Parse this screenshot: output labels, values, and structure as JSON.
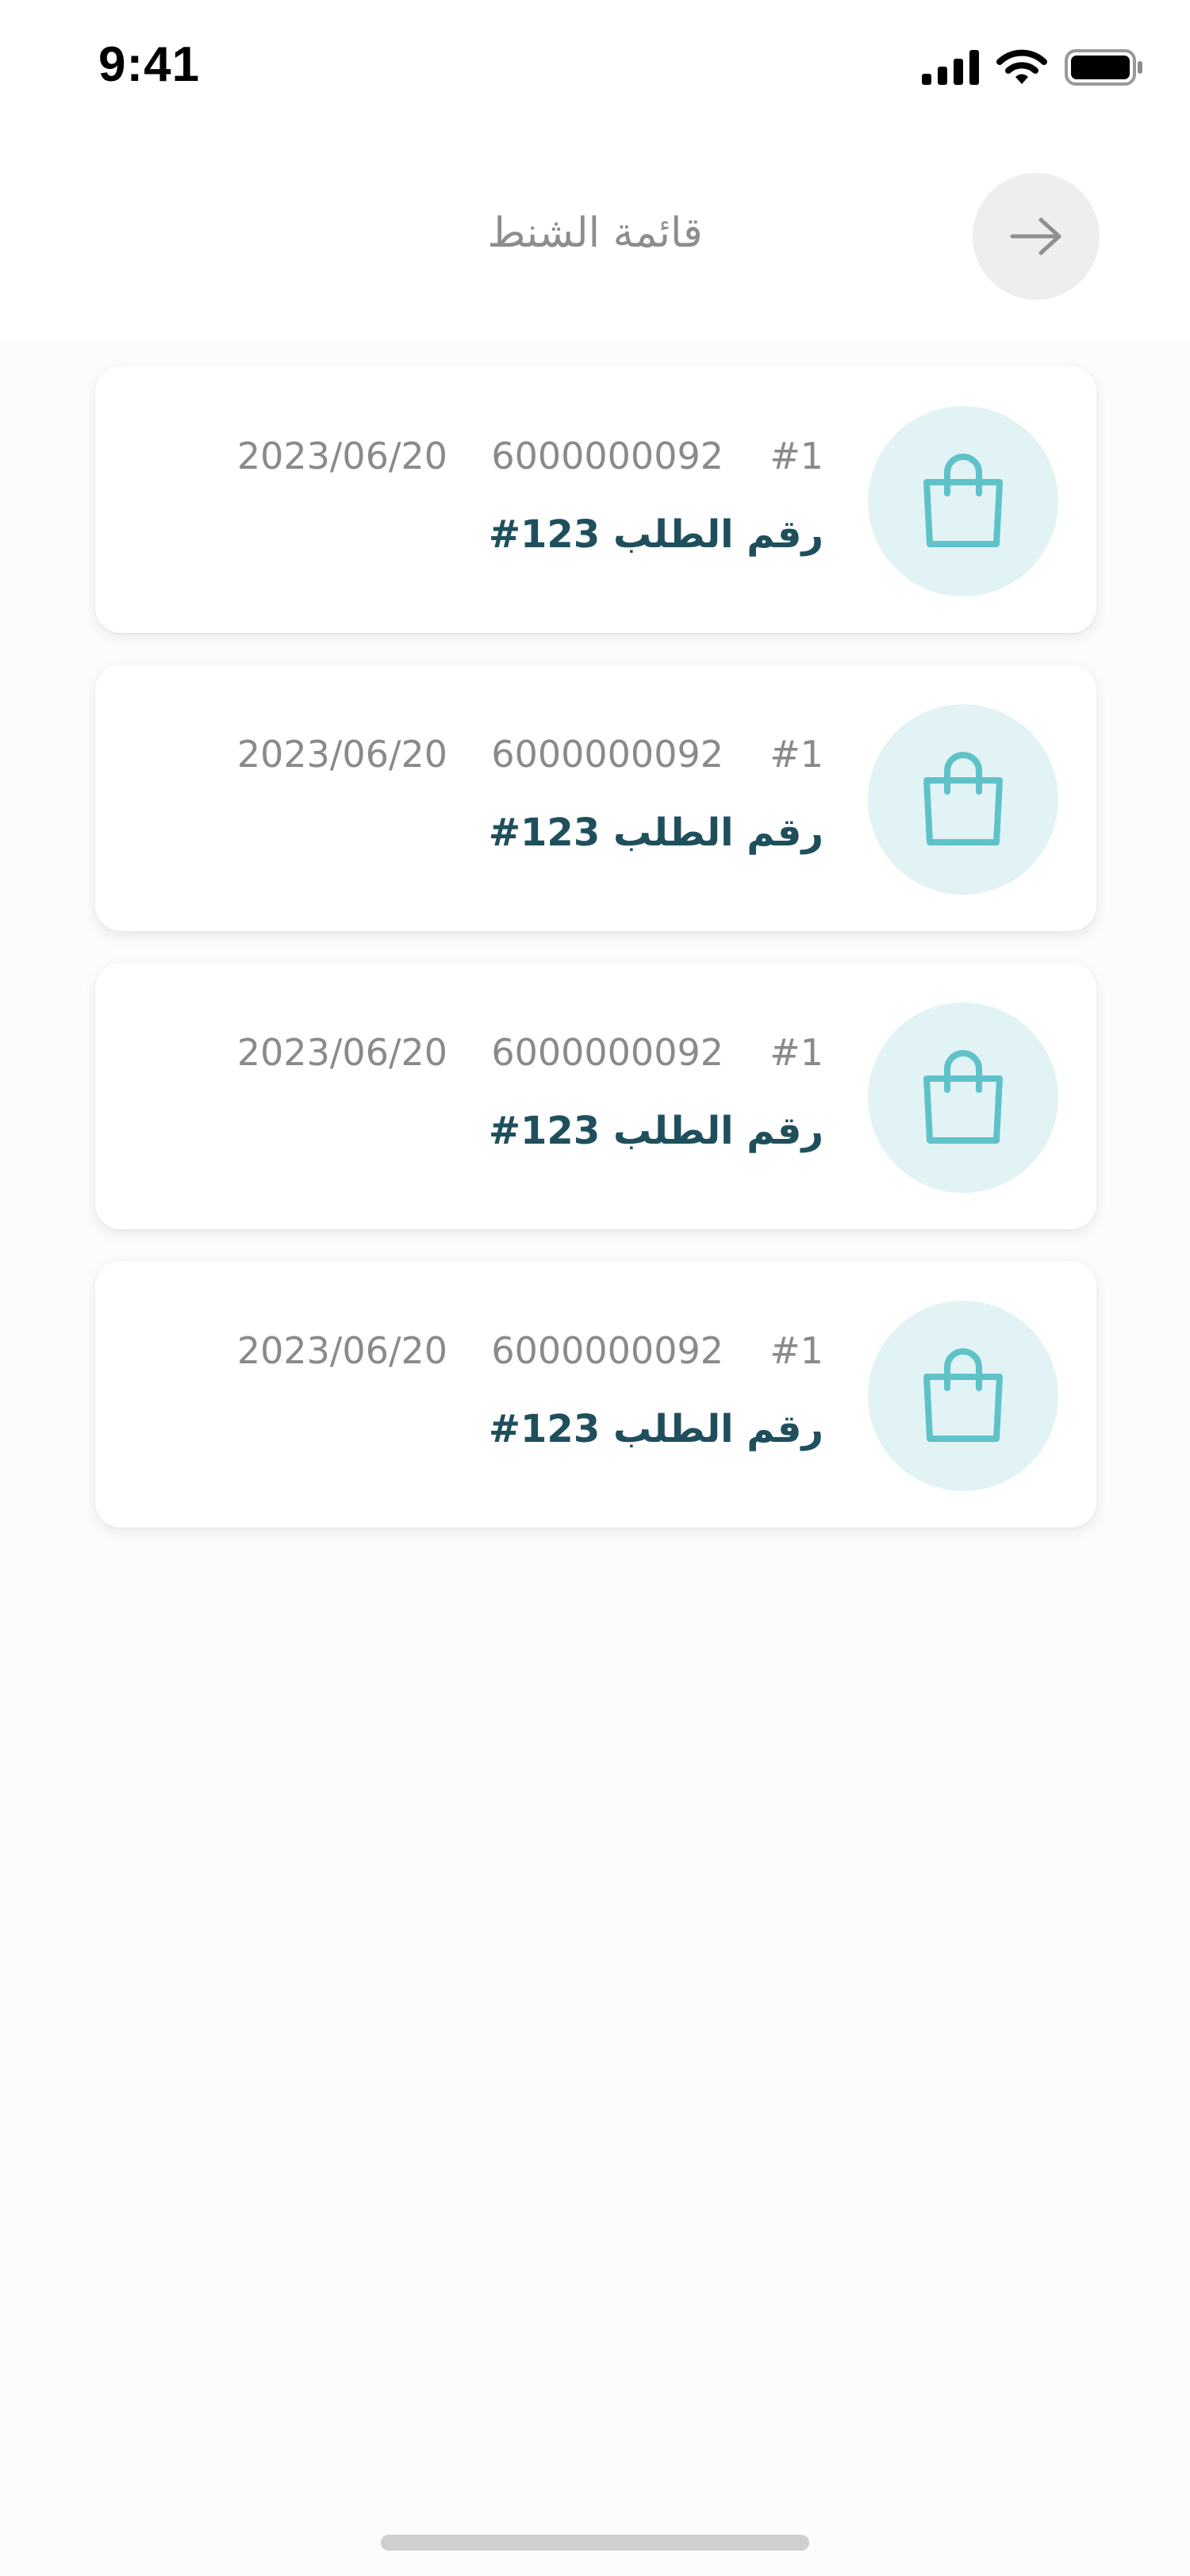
{
  "status_bar": {
    "time": "9:41",
    "icons": [
      "cellular-signal-icon",
      "wifi-icon",
      "battery-icon"
    ]
  },
  "header": {
    "title": "قائمة الشنط",
    "back_icon": "arrow-right-icon"
  },
  "colors": {
    "accent": "#5fc2c9",
    "accent_bg": "#e2f3f5",
    "title_text": "#1f4f5c",
    "muted_text": "#8a8a8a"
  },
  "bags": [
    {
      "icon": "shopping-bag-icon",
      "index": "#1",
      "code": "6000000092",
      "date": "2023/06/20",
      "title": "رقم الطلب 123#"
    },
    {
      "icon": "shopping-bag-icon",
      "index": "#1",
      "code": "6000000092",
      "date": "2023/06/20",
      "title": "رقم الطلب 123#"
    },
    {
      "icon": "shopping-bag-icon",
      "index": "#1",
      "code": "6000000092",
      "date": "2023/06/20",
      "title": "رقم الطلب 123#"
    },
    {
      "icon": "shopping-bag-icon",
      "index": "#1",
      "code": "6000000092",
      "date": "2023/06/20",
      "title": "رقم الطلب 123#"
    }
  ]
}
